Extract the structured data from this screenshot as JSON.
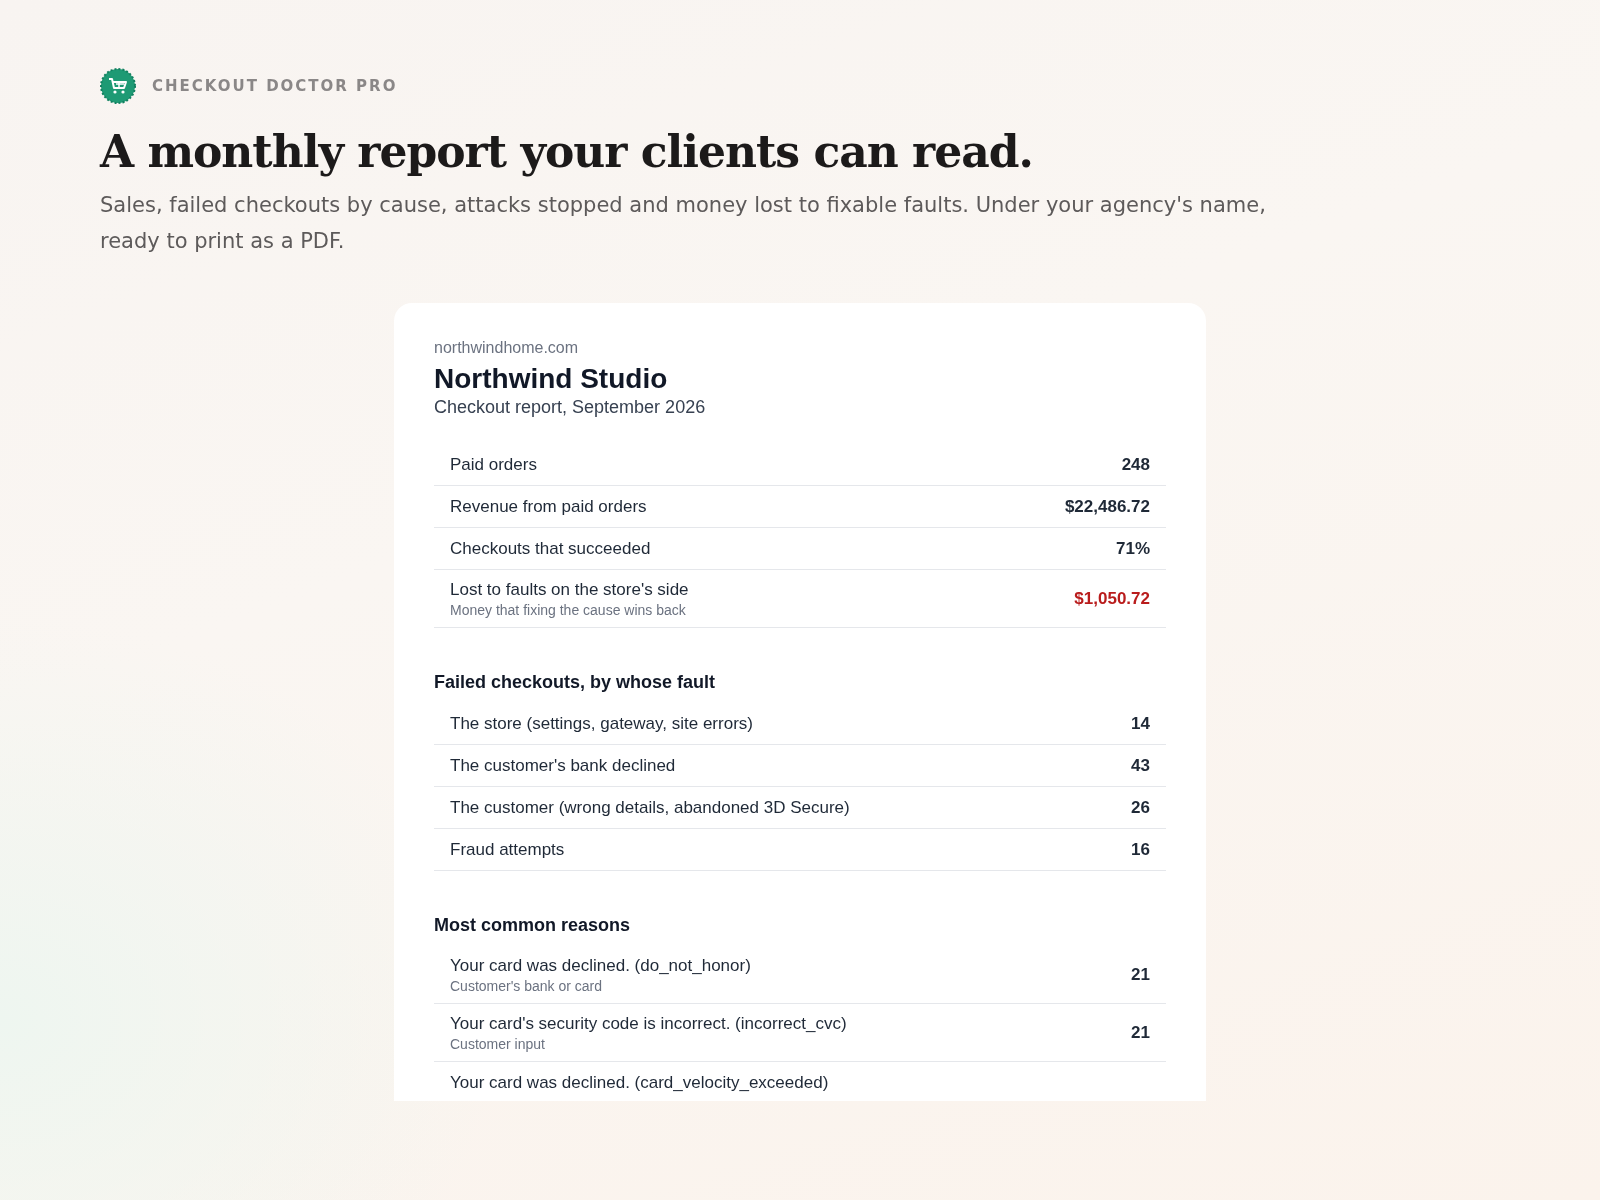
{
  "brand": {
    "name": "CHECKOUT DOCTOR PRO"
  },
  "hero": {
    "title": "A monthly report your clients can read.",
    "subtitle": "Sales, failed checkouts by cause, attacks stopped and money lost to fixable faults. Under your agency's name, ready to print as a PDF."
  },
  "report": {
    "domain": "northwindhome.com",
    "client": "Northwind Studio",
    "period": "Checkout report, September 2026",
    "summary": [
      {
        "label": "Paid orders",
        "value": "248",
        "alert": false
      },
      {
        "label": "Revenue from paid orders",
        "value": "$22,486.72",
        "alert": false
      },
      {
        "label": "Checkouts that succeeded",
        "value": "71%",
        "alert": false
      },
      {
        "label": "Lost to faults on the store's side",
        "note": "Money that fixing the cause wins back",
        "value": "$1,050.72",
        "alert": true
      }
    ],
    "sections": [
      {
        "title": "Failed checkouts, by whose fault",
        "rows": [
          {
            "label": "The store (settings, gateway, site errors)",
            "value": "14",
            "alert": false
          },
          {
            "label": "The customer's bank declined",
            "value": "43",
            "alert": false
          },
          {
            "label": "The customer (wrong details, abandoned 3D Secure)",
            "value": "26",
            "alert": false
          },
          {
            "label": "Fraud attempts",
            "value": "16",
            "alert": false
          }
        ]
      },
      {
        "title": "Most common reasons",
        "rows": [
          {
            "label": "Your card was declined. (do_not_honor)",
            "note": "Customer's bank or card",
            "value": "21",
            "alert": false
          },
          {
            "label": "Your card's security code is incorrect. (incorrect_cvc)",
            "note": "Customer input",
            "value": "21",
            "alert": false
          },
          {
            "label": "Your card was declined. (card_velocity_exceeded)"
          }
        ]
      }
    ]
  }
}
